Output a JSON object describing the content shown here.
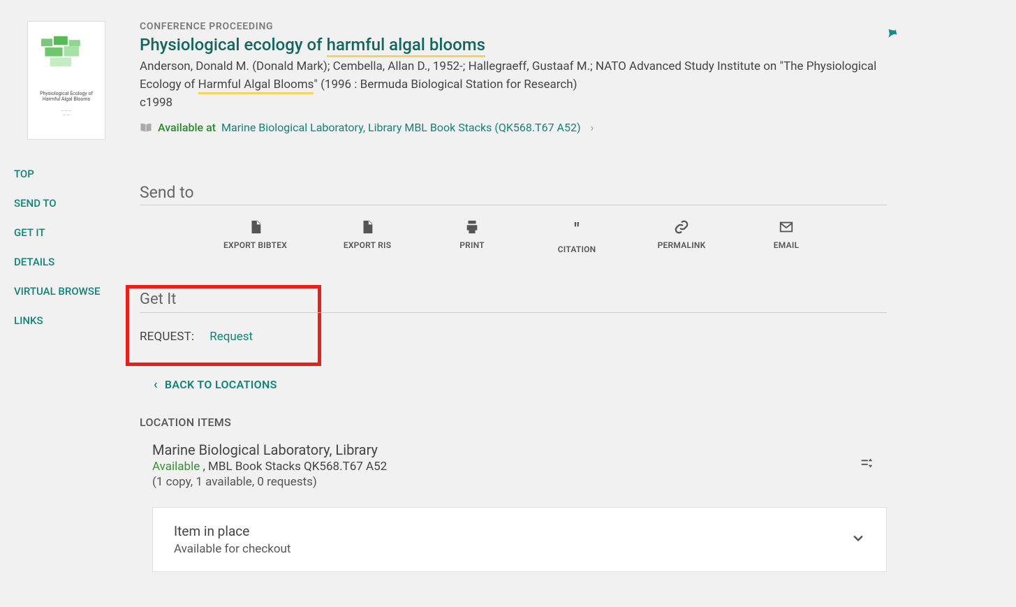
{
  "record": {
    "type_label": "CONFERENCE PROCEEDING",
    "title_pre": "Physiological ecology of ",
    "title_hl": "harmful algal blooms",
    "authors_pre": "Anderson, Donald M. (Donald Mark); Cembella, Allan D., 1952-; Hallegraeff, Gustaaf M.; NATO Advanced Study Institute on \"The Physiological Ecology of ",
    "authors_hl": "Harmful Algal Blooms",
    "authors_post": "\" (1996 : Bermuda Biological Station for Research)",
    "year": "c1998",
    "availability_status": "Available at",
    "location_link": "Marine Biological Laboratory, Library  MBL Book Stacks (QK568.T67 A52)",
    "thumb_title": "Physiological Ecology of Harmful Algal Blooms"
  },
  "sidebar": {
    "items": [
      {
        "label": "TOP"
      },
      {
        "label": "SEND TO"
      },
      {
        "label": "GET IT"
      },
      {
        "label": "DETAILS"
      },
      {
        "label": "VIRTUAL BROWSE"
      },
      {
        "label": "LINKS"
      }
    ]
  },
  "sendto": {
    "header": "Send to",
    "items": [
      {
        "label": "EXPORT BIBTEX"
      },
      {
        "label": "EXPORT RIS"
      },
      {
        "label": "PRINT"
      },
      {
        "label": "CITATION"
      },
      {
        "label": "PERMALINK"
      },
      {
        "label": "EMAIL"
      }
    ]
  },
  "getit": {
    "header": "Get It",
    "request_label": "REQUEST:",
    "request_link": "Request"
  },
  "locations": {
    "back_label": "BACK TO LOCATIONS",
    "section_label": "LOCATION ITEMS",
    "lib_name": "Marine Biological Laboratory, Library",
    "status": "Available",
    "shelf": ", MBL Book Stacks QK568.T67 A52",
    "copies": "(1 copy, 1 available, 0 requests)"
  },
  "item": {
    "status": "Item in place",
    "availability": "Available for checkout"
  }
}
